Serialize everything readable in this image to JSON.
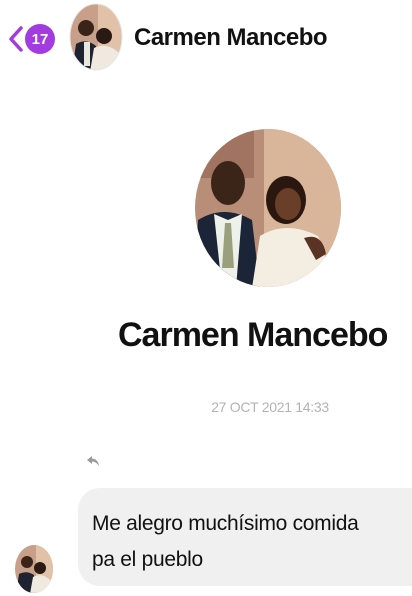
{
  "header": {
    "unread_count": "17",
    "contact_name": "Carmen Mancebo"
  },
  "profile": {
    "name": "Carmen Mancebo"
  },
  "conversation": {
    "timestamp": "27 OCT 2021 14:33",
    "message_lines": [
      "Me alegro muchísimo comida",
      "pa el pueblo"
    ]
  },
  "colors": {
    "accent": "#a23be0",
    "bubble": "#f0f0f0",
    "timestamp": "#b3b3b3"
  },
  "icons": {
    "back": "chevron-left-icon",
    "reply": "reply-icon"
  }
}
